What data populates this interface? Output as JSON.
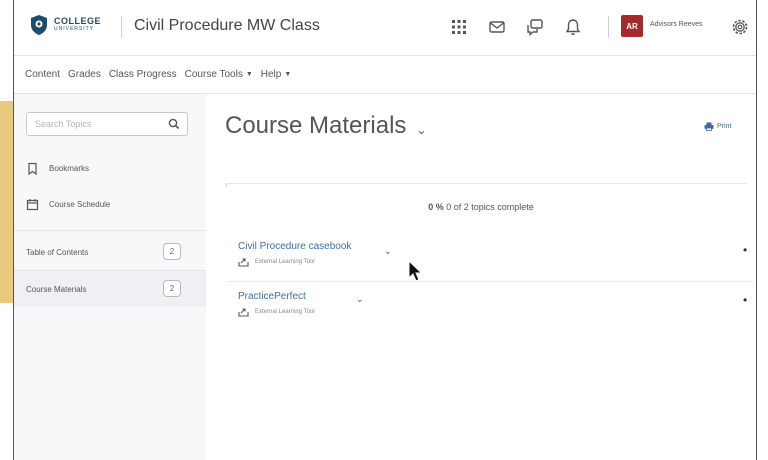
{
  "header": {
    "logo": {
      "line1": "COLLEGE",
      "line2": "UNIVERSITY"
    },
    "course_title": "Civil Procedure MW Class",
    "icons": [
      "apps-grid-icon",
      "mail-icon",
      "chat-icon",
      "bell-icon"
    ],
    "avatar_initials": "AR",
    "username": "Advisors Reeves",
    "settings_icon": "gear-icon"
  },
  "nav": {
    "items": [
      "Content",
      "Grades",
      "Class Progress",
      "Course Tools",
      "Help"
    ]
  },
  "sidebar": {
    "search_placeholder": "Search Topics",
    "links": [
      "Bookmarks",
      "Course Schedule"
    ],
    "toc": [
      {
        "label": "Table of Contents",
        "count": "2"
      },
      {
        "label": "Course Materials",
        "count": "2"
      }
    ]
  },
  "main": {
    "title": "Course Materials",
    "print_label": "Print",
    "progress": {
      "percent": "0 %",
      "text": "0 of 2 topics complete",
      "fraction": 0
    },
    "topics": [
      {
        "title": "Civil Procedure casebook",
        "type": "External Learning Tool"
      },
      {
        "title": "PracticePerfect",
        "type": "External Learning Tool"
      }
    ]
  },
  "colors": {
    "accent_left": "#e9c97e",
    "link": "#3d6ea8",
    "avatar": "#a52a2a",
    "brand": "#1f4b6e"
  }
}
